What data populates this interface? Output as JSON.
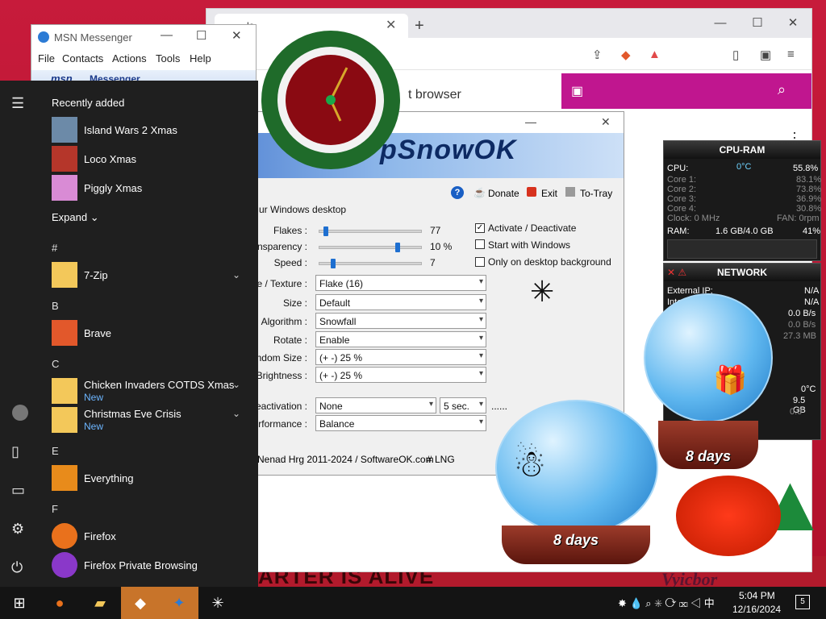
{
  "msn": {
    "title": "MSN Messenger",
    "menu": [
      "File",
      "Contacts",
      "Actions",
      "Tools",
      "Help"
    ],
    "brand": "msn",
    "brand_label": "Messenger"
  },
  "browser": {
    "tab_label": "lo",
    "page_text": "t browser"
  },
  "snow": {
    "banner_title": "pSnowOK",
    "toolbar": {
      "donate": "Donate",
      "exit": "Exit",
      "tray": "To-Tray"
    },
    "group_title": "ur Windows desktop",
    "sliders": [
      {
        "label": "Flakes :",
        "value": "77",
        "level": 0.05
      },
      {
        "label": "ransparency :",
        "value": "10 %",
        "level": 0.78
      },
      {
        "label": "Speed :",
        "value": "7",
        "level": 0.12
      }
    ],
    "checks": [
      {
        "label": "Activate / Deactivate",
        "checked": true
      },
      {
        "label": "Start with Windows",
        "checked": false
      },
      {
        "label": "Only on desktop background",
        "checked": false
      }
    ],
    "combos": [
      {
        "label": "ge / Texture :",
        "value": "Flake (16)"
      },
      {
        "label": "Size :",
        "value": "Default"
      },
      {
        "label": "Algorithm :",
        "value": "Snowfall"
      },
      {
        "label": "Rotate :",
        "value": "Enable"
      },
      {
        "label": "Random Size :",
        "value": "(+ -) 25 %"
      },
      {
        "label": "m Brightness :",
        "value": "(+ -) 25 %"
      }
    ],
    "deactivation": {
      "label": "Deactivation :",
      "value": "None",
      "seconds": "5 sec.",
      "dots": "......"
    },
    "performance": {
      "label": "Performance :",
      "value": "Balance"
    },
    "footer_left": "Nenad Hrg 2011-2024 / SoftwareOK.com",
    "footer_right": "# LNG"
  },
  "start_menu": {
    "recently_added_title": "Recently added",
    "recent": [
      {
        "label": "Island Wars 2 Xmas",
        "color": "#6c8aa8"
      },
      {
        "label": "Loco Xmas",
        "color": "#b5362a"
      },
      {
        "label": "Piggly Xmas",
        "color": "#d98bd5"
      }
    ],
    "expand_label": "Expand",
    "sections": [
      {
        "letter": "#",
        "apps": [
          {
            "label": "7-Zip",
            "new": "",
            "color": "#f3c85a",
            "chevron": true
          }
        ]
      },
      {
        "letter": "B",
        "apps": [
          {
            "label": "Brave",
            "new": "",
            "color": "#e2582b",
            "chevron": false
          }
        ]
      },
      {
        "letter": "C",
        "apps": [
          {
            "label": "Chicken Invaders COTDS Xmas",
            "new": "New",
            "color": "#f3c85a",
            "chevron": true
          },
          {
            "label": "Christmas Eve Crisis",
            "new": "New",
            "color": "#f3c85a",
            "chevron": true
          }
        ]
      },
      {
        "letter": "E",
        "apps": [
          {
            "label": "Everything",
            "new": "",
            "color": "#e88b1b",
            "chevron": false
          }
        ]
      },
      {
        "letter": "F",
        "apps": [
          {
            "label": "Firefox",
            "new": "",
            "color": "#e9711c",
            "chevron": false
          },
          {
            "label": "Firefox Private Browsing",
            "new": "",
            "color": "#8a38c9",
            "chevron": false
          }
        ]
      }
    ]
  },
  "cpu_gadget": {
    "title": "CPU-RAM",
    "cpu_label": "CPU:",
    "cpu_temp": "0°C",
    "cpu_pct": "55.8%",
    "cores": [
      {
        "label": "Core 1:",
        "value": "83.1%"
      },
      {
        "label": "Core 2:",
        "value": "73.8%"
      },
      {
        "label": "Core 3:",
        "value": "36.9%"
      },
      {
        "label": "Core 4:",
        "value": "30.8%"
      }
    ],
    "clock": "Clock: 0 MHz",
    "fan": "FAN: 0rpm",
    "ram_label": "RAM:",
    "ram_value": "1.6 GB/4.0 GB",
    "ram_pct": "41%"
  },
  "net_gadget": {
    "title": "NETWORK",
    "external_ip_label": "External IP:",
    "external_ip_value": "N/A",
    "internal_label": "Intern",
    "internal_value": "N/A",
    "rate1": "0.0 B/s",
    "rate2": "0.0 B/s",
    "rate3": "27.3 MB",
    "temp": "0°C",
    "size": "9.5 GB",
    "small": "0.0"
  },
  "globes": {
    "left_label": "8 days",
    "right_label": "8 days"
  },
  "wallpaper": {
    "banner": "ARTER IS ALIVE",
    "signature": "Vyicbor"
  },
  "taskbar": {
    "time": "5:04 PM",
    "date": "12/16/2024",
    "notification_count": "5"
  }
}
